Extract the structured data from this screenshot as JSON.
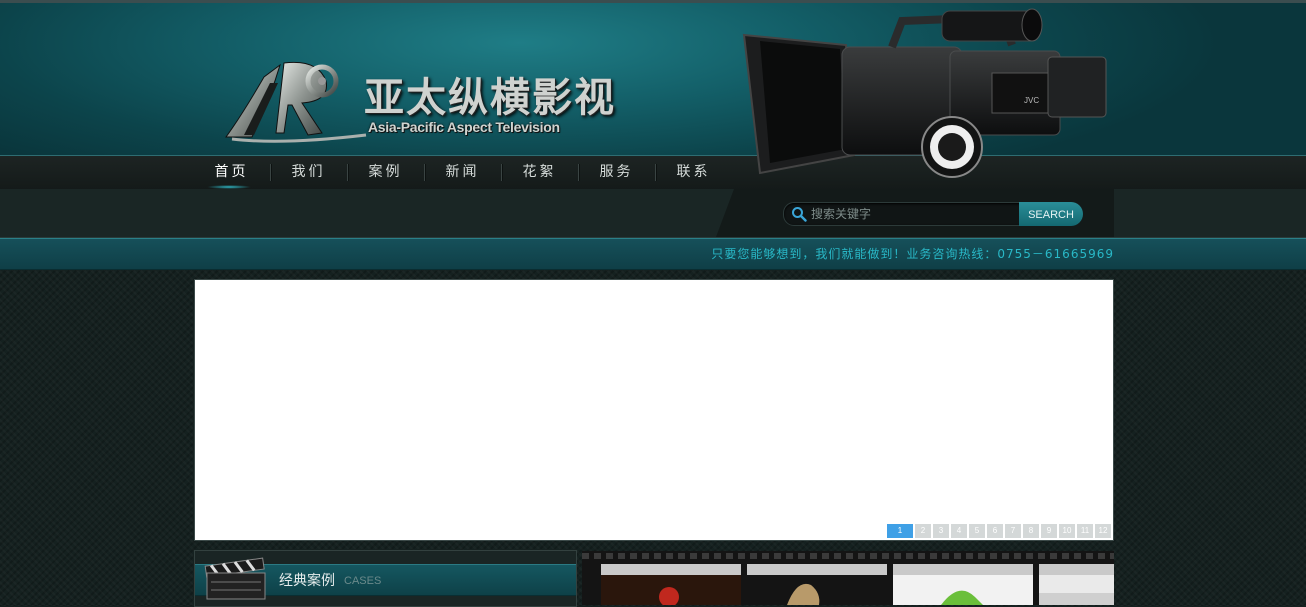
{
  "brand": {
    "name_cn": "亚太纵横影视",
    "name_en": "Asia-Pacific Aspect Television"
  },
  "nav": {
    "items": [
      {
        "label": "首页",
        "active": true
      },
      {
        "label": "我们"
      },
      {
        "label": "案例"
      },
      {
        "label": "新闻"
      },
      {
        "label": "花絮"
      },
      {
        "label": "服务"
      },
      {
        "label": "联系"
      }
    ]
  },
  "search": {
    "placeholder": "搜索关键字",
    "button_label": "SEARCH"
  },
  "slogan": "只要您能够想到，我们就能做到！业务咨询热线：0755－61665969",
  "banner": {
    "pages": [
      "1",
      "2",
      "3",
      "4",
      "5",
      "6",
      "7",
      "8",
      "9",
      "10",
      "11",
      "12"
    ],
    "active_page": "1"
  },
  "cases": {
    "title": "经典案例",
    "subtitle": "CASES"
  },
  "colors": {
    "accent": "#29b8c7",
    "header_teal": "#135f68",
    "pager_active": "#3fa0e6"
  }
}
